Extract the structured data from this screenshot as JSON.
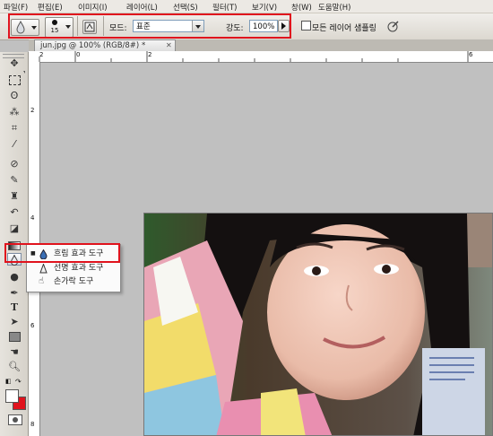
{
  "menu": [
    "파일(F)",
    "편집(E)",
    "이미지(I)",
    "레이어(L)",
    "선택(S)",
    "필터(T)",
    "보기(V)",
    "창(W)",
    "도움말(H)"
  ],
  "options": {
    "brush_size": "15",
    "mode_label": "모드:",
    "mode_value": "표준",
    "strength_label": "강도:",
    "strength_value": "100%",
    "sample_all_label": "모든 레이어 샘플링"
  },
  "tab": {
    "title": "jun.jpg @ 100% (RGB/8#) *",
    "close": "✕"
  },
  "ruler_h": [
    "2",
    "0",
    "2",
    "4",
    "6"
  ],
  "ruler_v": [
    "2",
    "4",
    "6",
    "8"
  ],
  "flyout": [
    {
      "marker": "■",
      "label": "흐림 효과 도구"
    },
    {
      "marker": "",
      "label": "선명 효과 도구"
    },
    {
      "marker": "",
      "label": "손가락 도구"
    }
  ],
  "colors": {
    "highlight": "#e0131d",
    "foreground": "#ffffff",
    "background": "#e0131d"
  }
}
